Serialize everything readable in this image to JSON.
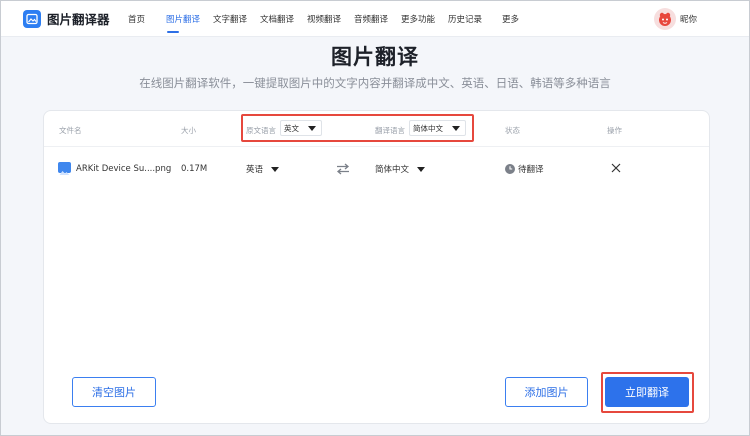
{
  "app": {
    "name": "图片翻译器",
    "logo_icon": "image-icon"
  },
  "nav": {
    "items": [
      {
        "label": "首页"
      },
      {
        "label": "图片翻译",
        "active": true
      },
      {
        "label": "文字翻译"
      },
      {
        "label": "文档翻译"
      },
      {
        "label": "视频翻译"
      },
      {
        "label": "音频翻译"
      },
      {
        "label": "更多功能"
      },
      {
        "label": "历史记录"
      },
      {
        "label": "更多"
      }
    ]
  },
  "user": {
    "nickname": "昵你",
    "avatar_icon": "cartoon-avatar-icon"
  },
  "page": {
    "title": "图片翻译",
    "subtitle": "在线图片翻译软件，一键提取图片中的文字内容并翻译成中文、英语、日语、韩语等多种语言"
  },
  "table": {
    "headers": {
      "filename": "文件名",
      "size": "大小",
      "source_lang_label": "原文语言",
      "source_lang_value": "英文",
      "target_lang_label": "翻译语言",
      "target_lang_value": "简体中文",
      "status": "状态",
      "action": "操作"
    },
    "rows": [
      {
        "filename": "ARKit Device Su....png",
        "size": "0.17M",
        "source_lang": "英语",
        "target_lang": "简体中文",
        "status": "待翻译"
      }
    ]
  },
  "buttons": {
    "clear": "清空图片",
    "add": "添加图片",
    "translate": "立即翻译"
  },
  "colors": {
    "accent": "#2d6fe6",
    "primary_button": "#2d72eb",
    "highlight_red": "#e6483d",
    "background": "#f4f6fa"
  }
}
